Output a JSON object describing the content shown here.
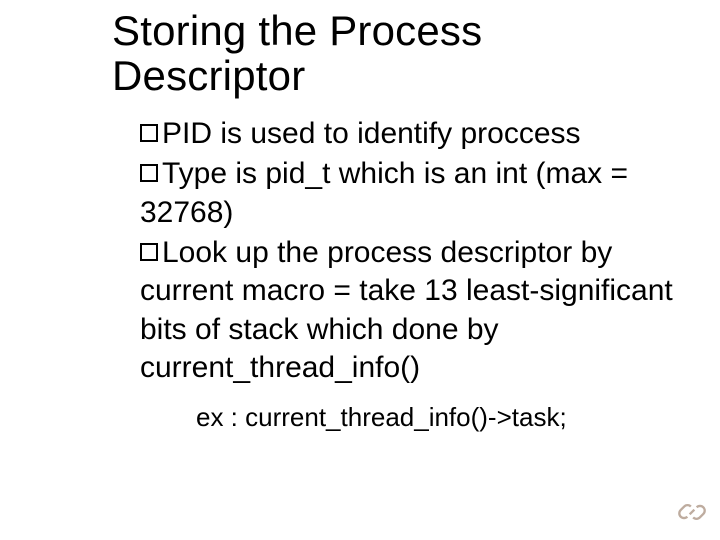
{
  "title": "Storing the Process Descriptor",
  "bullets": [
    "PID is used to identify proccess",
    "Type is pid_t which is an int (max = 32768)",
    "Look up the process descriptor by current macro = take 13 least-significant bits of stack which done by current_thread_info()"
  ],
  "example": "ex : current_thread_info()->task;"
}
